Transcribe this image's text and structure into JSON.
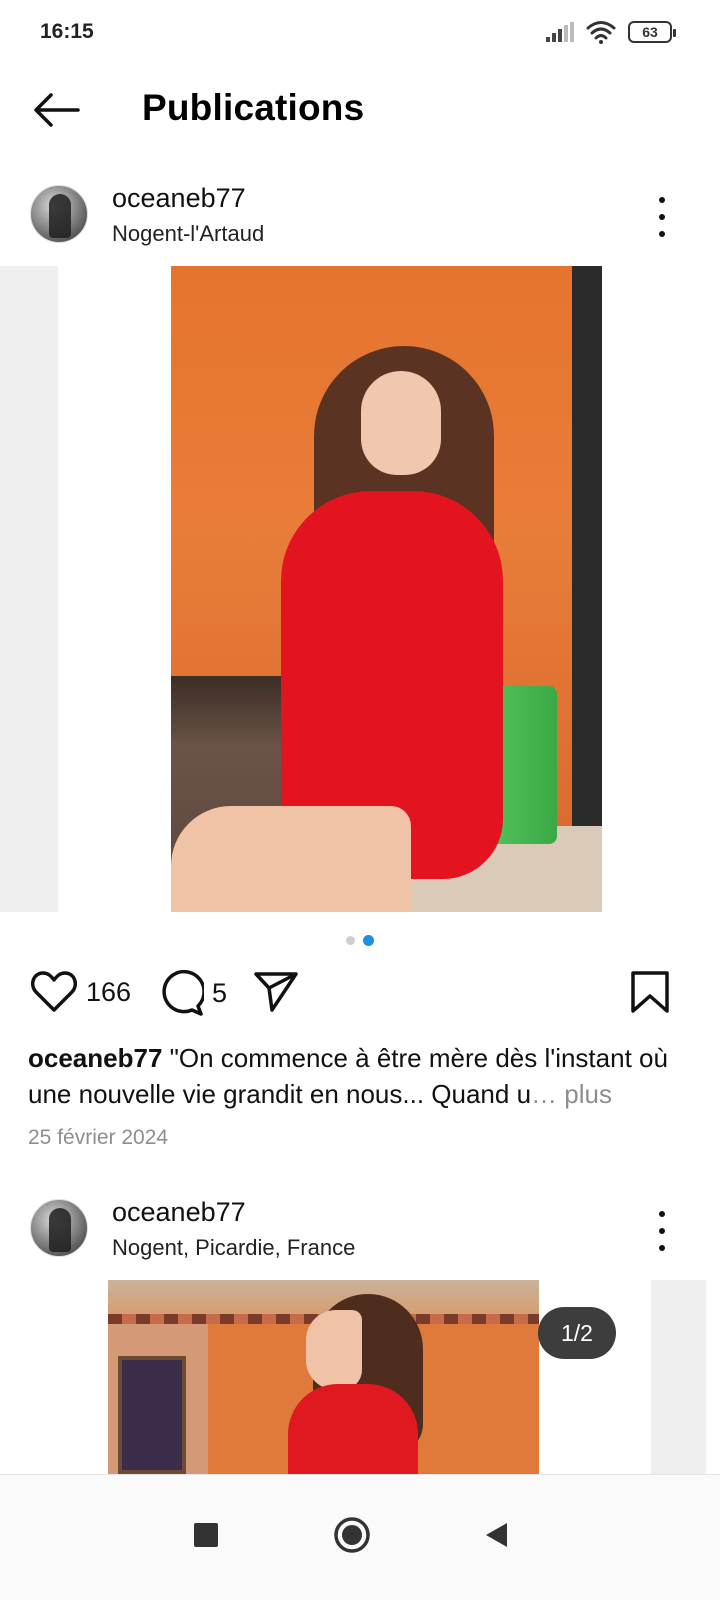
{
  "status_bar": {
    "time": "16:15",
    "battery_level": "63"
  },
  "header": {
    "title": "Publications"
  },
  "posts": [
    {
      "username": "oceaneb77",
      "location": "Nogent-l'Artaud",
      "likes": "166",
      "comments": "5",
      "caption_user": "oceaneb77",
      "caption_text": " \"On commence à être mère dès l'instant où une nouvelle vie grandit en nous... Quand u",
      "caption_more": "… plus",
      "date": "25 février 2024",
      "carousel_active_index": 2,
      "carousel_total": 2
    },
    {
      "username": "oceaneb77",
      "location": "Nogent, Picardie, France",
      "image_counter": "1/2"
    }
  ],
  "colors": {
    "accent_dot": "#1c8fe6",
    "secondary_text": "#8e8e8e"
  },
  "icons": {
    "back": "arrow-left-icon",
    "more": "more-vertical-icon",
    "like": "heart-icon",
    "comment": "comment-icon",
    "share": "send-icon",
    "save": "bookmark-icon"
  }
}
